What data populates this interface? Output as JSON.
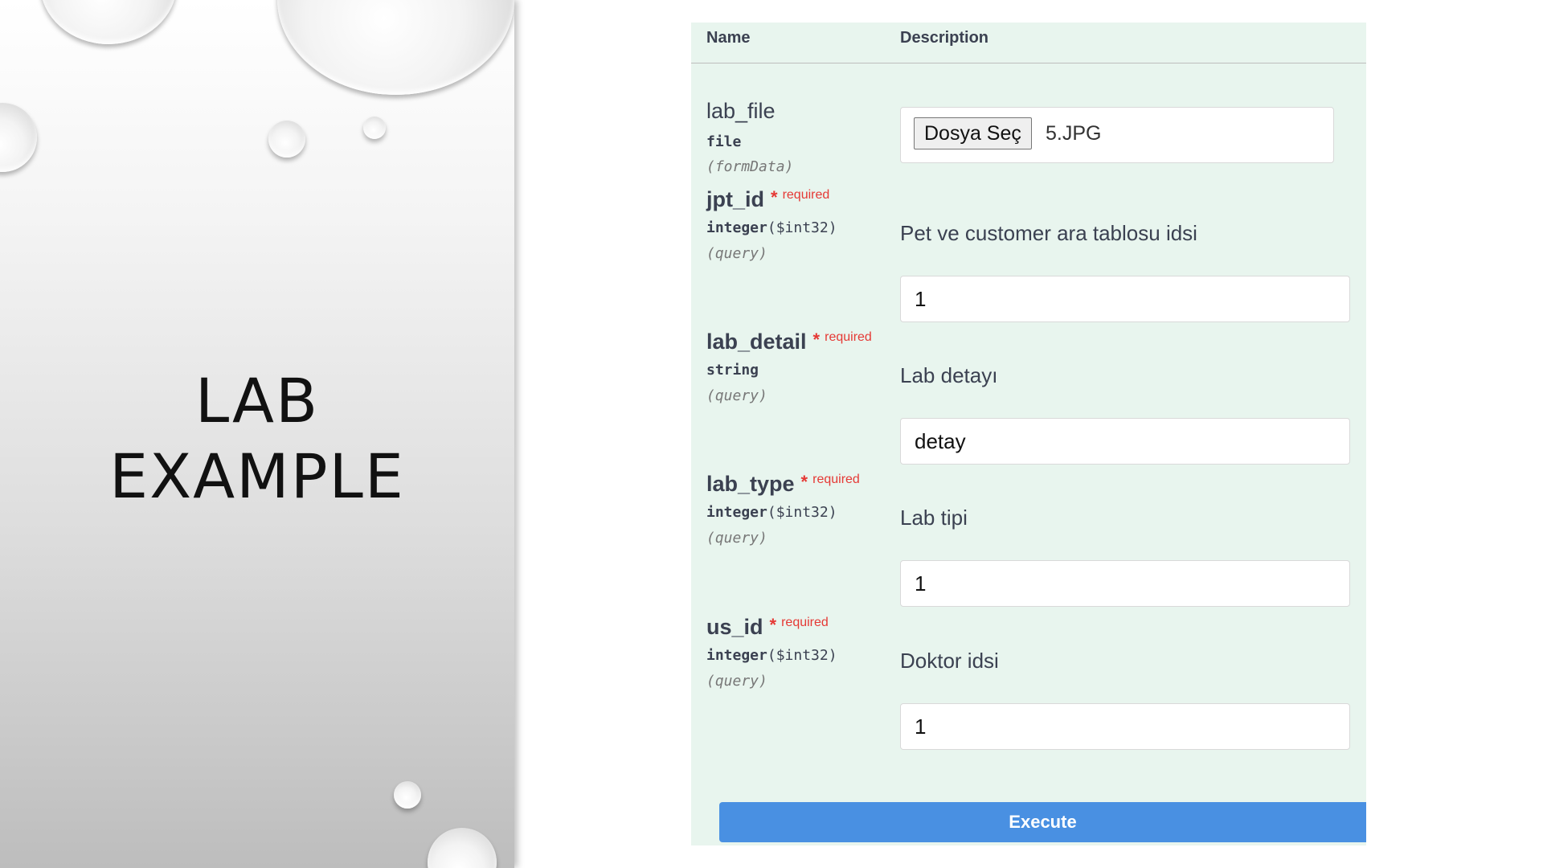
{
  "slide": {
    "title_line1": "LAB",
    "title_line2": "EXAMPLE"
  },
  "table": {
    "col_name": "Name",
    "col_description": "Description"
  },
  "params": [
    {
      "name": "lab_file",
      "type": "file",
      "format": "",
      "in": "(formData)",
      "required": false,
      "file_button": "Dosya Seç",
      "file_name": "5.JPG"
    },
    {
      "name": "jpt_id",
      "type": "integer",
      "format": "($int32)",
      "in": "(query)",
      "required": true,
      "required_marker": "*",
      "required_label": "required",
      "description": "Pet ve customer ara tablosu idsi",
      "value": "1"
    },
    {
      "name": "lab_detail",
      "type": "string",
      "format": "",
      "in": "(query)",
      "required": true,
      "required_marker": "*",
      "required_label": "required",
      "description": "Lab detayı",
      "value": "detay"
    },
    {
      "name": "lab_type",
      "type": "integer",
      "format": "($int32)",
      "in": "(query)",
      "required": true,
      "required_marker": "*",
      "required_label": "required",
      "description": "Lab tipi",
      "value": "1"
    },
    {
      "name": "us_id",
      "type": "integer",
      "format": "($int32)",
      "in": "(query)",
      "required": true,
      "required_marker": "*",
      "required_label": "required",
      "description": "Doktor idsi",
      "value": "1"
    }
  ],
  "execute_label": "Execute",
  "colors": {
    "panel_bg": "#e8f5ee",
    "execute_bg": "#4990e2",
    "required": "#e53935",
    "text": "#3b4151"
  }
}
